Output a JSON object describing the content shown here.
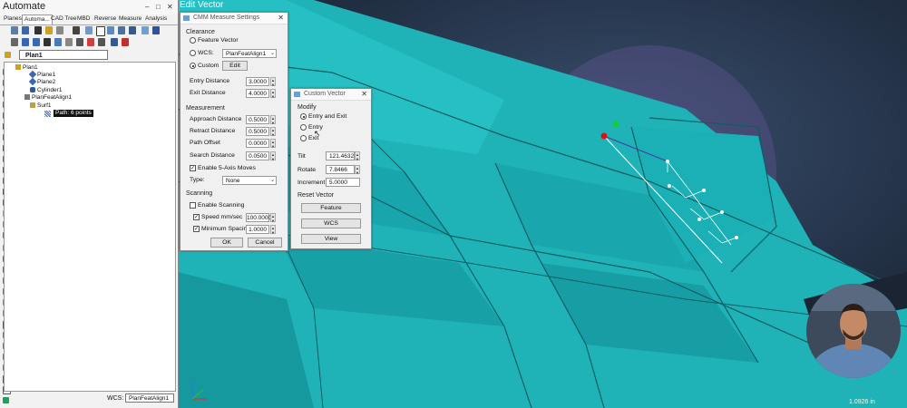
{
  "app": {
    "title": "Automate",
    "minimize": "–",
    "restore": "□",
    "close": "✕"
  },
  "tabs": [
    "Planes",
    "Automa...",
    "CAD Tree",
    "MBD",
    "Reverse",
    "Measure",
    "Analysis"
  ],
  "plan_select": {
    "value": "Plan1"
  },
  "tree": {
    "root": "Plan1",
    "items": [
      "Plane1",
      "Plane2",
      "Cylinder1",
      "PlanFeatAlign1",
      "Surf1"
    ],
    "path_tooltip": "Path: 6 points"
  },
  "bottom_wcs": {
    "label": "WCS:",
    "value": "PlanFeatAlign1"
  },
  "viewport": {
    "title": "Edit Vector",
    "scale_readout": "1.0926 in"
  },
  "cmm_dialog": {
    "title": "CMM Measure Settings",
    "clearance": {
      "header": "Clearance",
      "feature_vector": "Feature Vector",
      "wcs_label": "WCS:",
      "wcs_value": "PlanFeatAlign1",
      "custom": "Custom",
      "edit": "Edit",
      "entry_distance_label": "Entry Distance",
      "entry_distance": "3.0000",
      "exit_distance_label": "Exit Distance",
      "exit_distance": "4.0000"
    },
    "measurement": {
      "header": "Measurement",
      "approach_label": "Approach Distance",
      "approach": "0.5000",
      "retract_label": "Retract Distance",
      "retract": "0.5000",
      "path_offset_label": "Path Offset",
      "path_offset": "0.0000",
      "search_label": "Search Distance",
      "search": "0.0500",
      "enable_5axis": "Enable 5-Axis Moves",
      "type_label": "Type:",
      "type_value": "None"
    },
    "scanning": {
      "header": "Scanning",
      "enable_scanning": "Enable Scanning",
      "speed_label": "Speed mm/sec",
      "speed": "100.0000",
      "min_spacing_label": "Minimum Spacing",
      "min_spacing": "1.0000"
    },
    "ok": "OK",
    "cancel": "Cancel"
  },
  "custom_vector": {
    "title": "Custom Vector",
    "modify": "Modify",
    "entry_exit": "Entry and Exit",
    "entry": "Entry",
    "exit": "Exit",
    "tilt_label": "Tilt",
    "tilt": "121.4632",
    "rotate_label": "Rotate",
    "rotate": "7.8466",
    "increment_label": "Increment",
    "increment": "5.0000",
    "reset_vector": "Reset Vector",
    "feature": "Feature",
    "wcs": "WCS",
    "view": "View"
  }
}
